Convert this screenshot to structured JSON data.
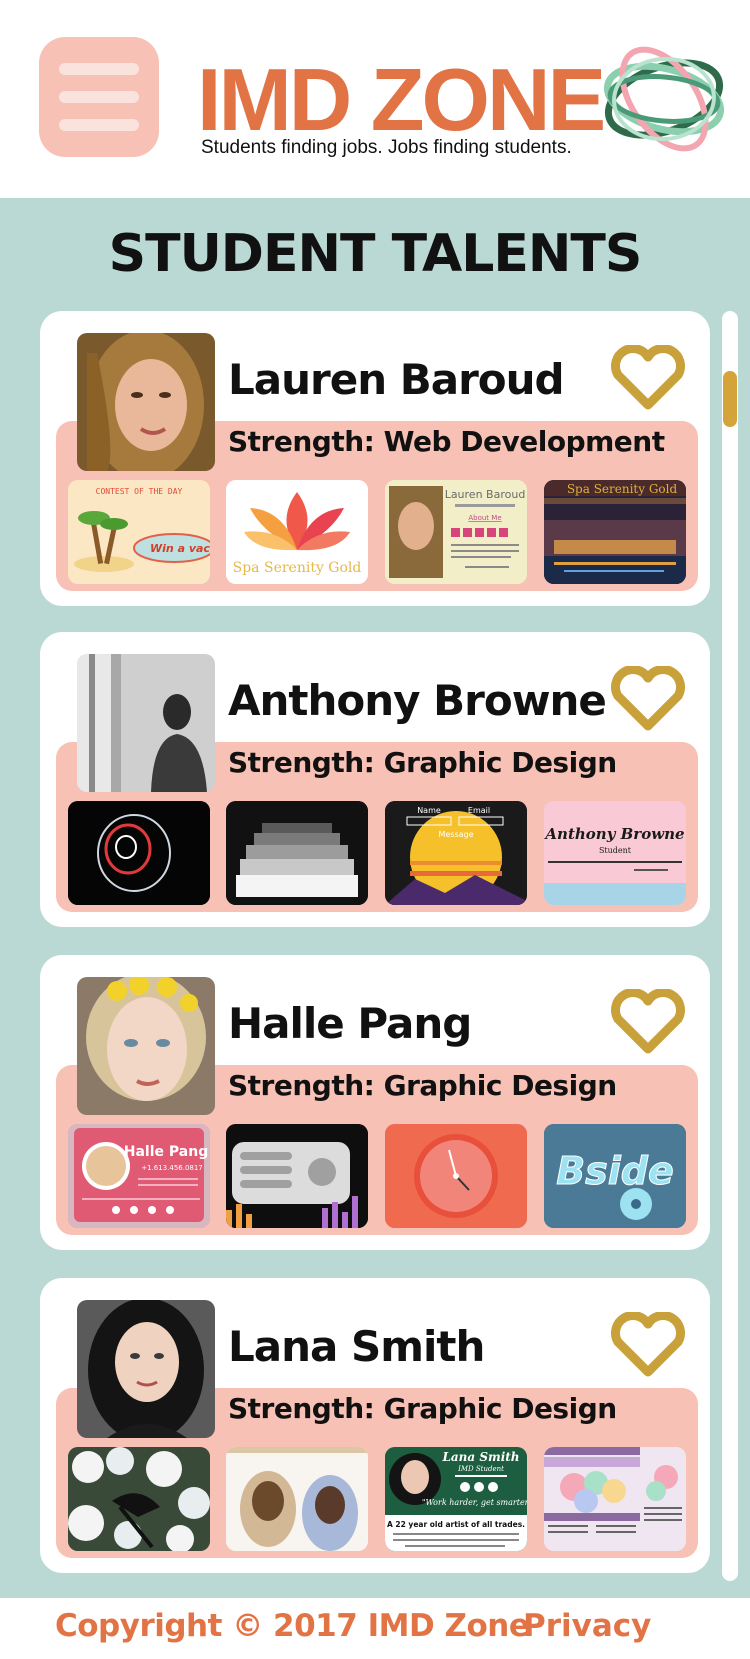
{
  "header": {
    "logo_text": "IMD ZONE",
    "tagline": "Students finding jobs. Jobs finding students.",
    "menu_icon": "hamburger-menu-icon",
    "logo_icon": "rings-logo-icon"
  },
  "main": {
    "title": "STUDENT TALENTS"
  },
  "colors": {
    "accent_orange": "#e27345",
    "band_pink": "#f8c1b6",
    "background_teal": "#bad8d4",
    "heart_gold": "#c9a13a"
  },
  "students": [
    {
      "name": "Lauren Baroud",
      "strength": "Strength: Web Development",
      "favorite_icon": "heart-outline-icon",
      "portfolio": {
        "t1_caption": "CONTEST OF THE DAY",
        "t1_cta": "Win a vacation",
        "t2_caption": "Spa Serenity Gold",
        "t3_name": "Lauren Baroud",
        "t3_link": "About Me",
        "t4_caption": "Spa Serenity Gold"
      }
    },
    {
      "name": "Anthony Browne",
      "strength": "Strength: Graphic Design",
      "favorite_icon": "heart-outline-icon",
      "portfolio": {
        "t3_name_label": "Name",
        "t3_email_label": "Email",
        "t3_message_label": "Message",
        "t4_name": "Anthony Browne",
        "t4_role": "Student"
      }
    },
    {
      "name": "Halle Pang",
      "strength": "Strength: Graphic Design",
      "favorite_icon": "heart-outline-icon",
      "portfolio": {
        "t1_name": "Halle Pang",
        "t1_phone": "+1.613.456.0817",
        "t4_caption": "Bside"
      }
    },
    {
      "name": "Lana Smith",
      "strength": "Strength: Graphic Design",
      "favorite_icon": "heart-outline-icon",
      "portfolio": {
        "t3_name": "Lana Smith",
        "t3_role": "IMD Student",
        "t3_quote": "\"Work harder, get smarter\"",
        "t3_headline": "A 22 year old artist of all trades."
      }
    }
  ],
  "footer": {
    "copyright": "Copyright © 2017 IMD Zone",
    "privacy": "Privacy"
  }
}
